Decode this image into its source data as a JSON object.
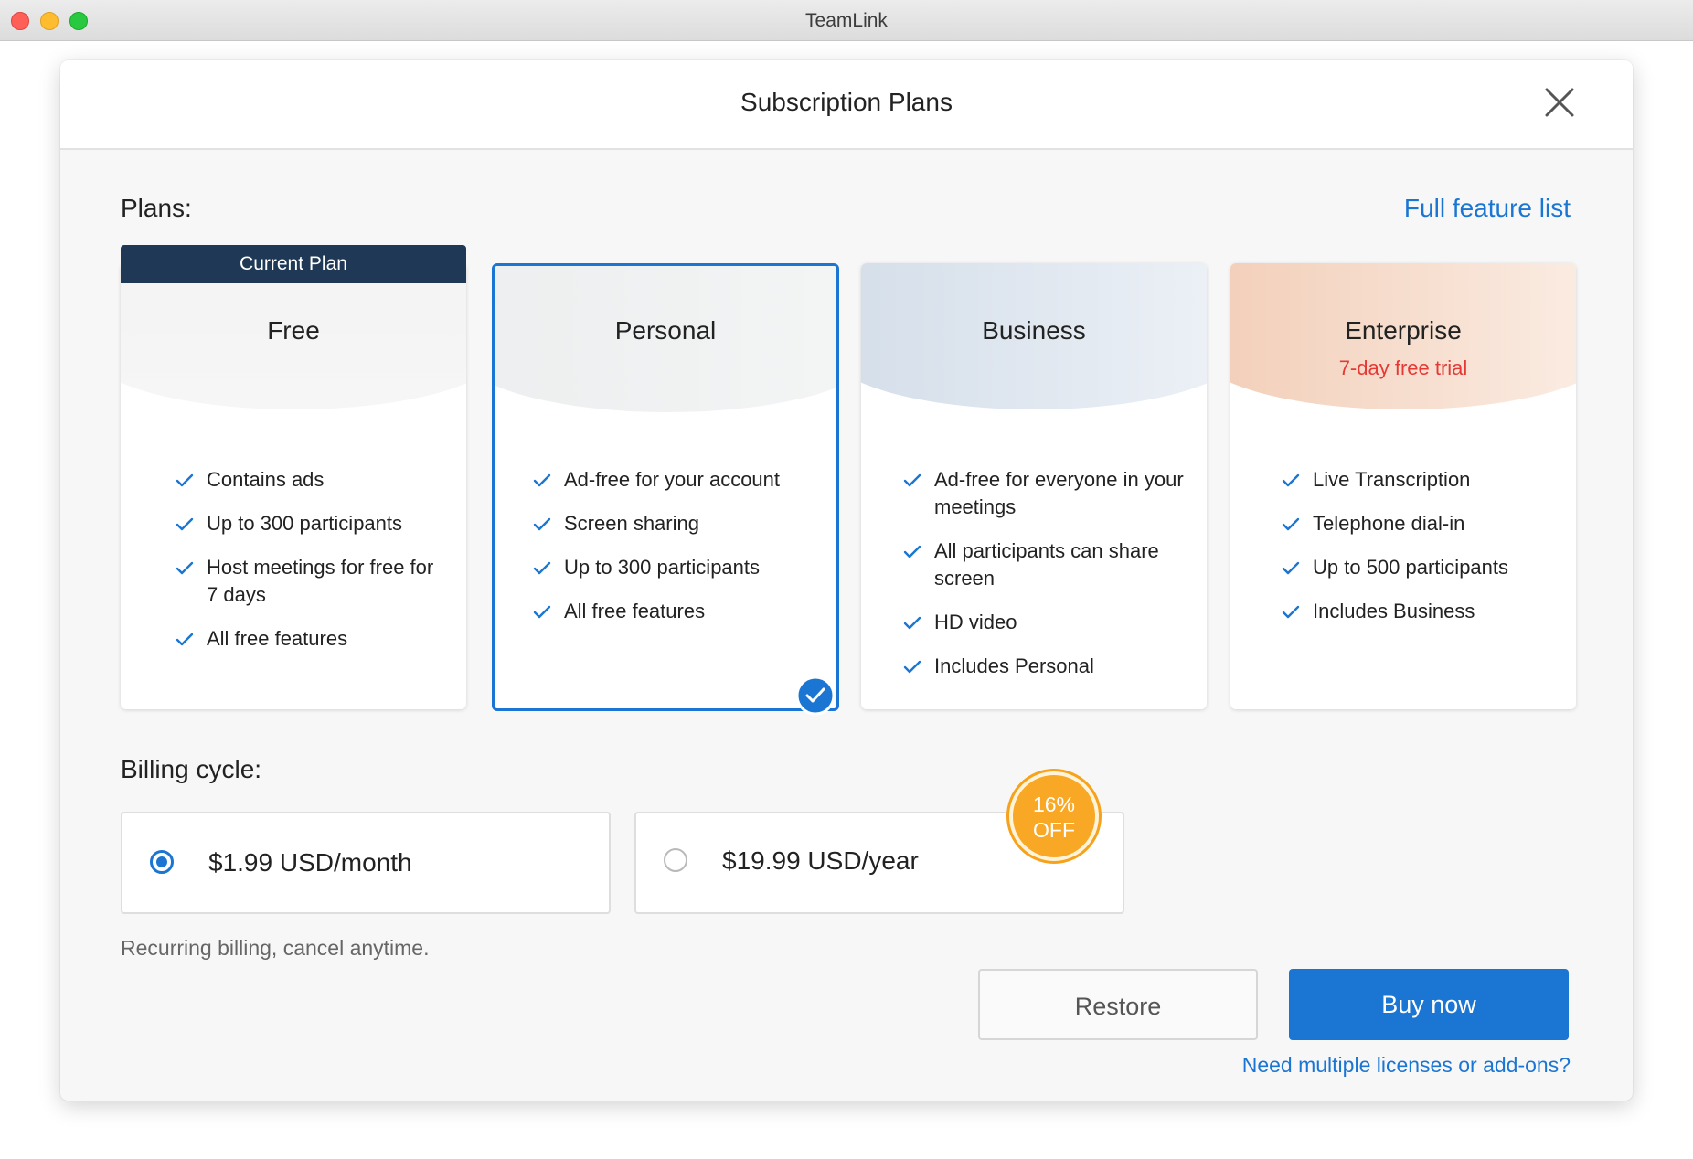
{
  "window": {
    "title": "TeamLink"
  },
  "dialog": {
    "title": "Subscription Plans"
  },
  "plans_section": {
    "label": "Plans:",
    "feature_link": "Full feature list",
    "current_badge": "Current Plan",
    "plans": [
      {
        "name": "Free",
        "trial": "",
        "features": [
          "Contains ads",
          "Up to 300 participants",
          "Host meetings for free for 7 days",
          "All free features"
        ]
      },
      {
        "name": "Personal",
        "trial": "",
        "selected": true,
        "features": [
          "Ad-free for your account",
          "Screen sharing",
          "Up to 300 participants",
          "All free features"
        ]
      },
      {
        "name": "Business",
        "trial": "",
        "features": [
          "Ad-free for everyone in your meetings",
          "All participants can share screen",
          "HD video",
          "Includes Personal"
        ]
      },
      {
        "name": "Enterprise",
        "trial": "7-day free trial",
        "features": [
          "Live Transcription",
          "Telephone dial-in",
          "Up to 500 participants",
          "Includes Business"
        ]
      }
    ]
  },
  "billing": {
    "label": "Billing cycle:",
    "monthly": {
      "amount": "$1.99",
      "unit": "USD/month",
      "selected": true
    },
    "yearly": {
      "amount": "$19.99",
      "unit": "USD/year",
      "selected": false
    },
    "discount_badge": {
      "line1": "16%",
      "line2": "OFF"
    },
    "note": "Recurring billing, cancel anytime."
  },
  "actions": {
    "restore_label": "Restore",
    "buy_label": "Buy now",
    "multiple_licenses_link": "Need multiple licenses or add-ons?"
  },
  "colors": {
    "accent": "#1b76d3",
    "badge_dark": "#1f3855",
    "trial_red": "#e53935",
    "discount_orange": "#f9a825"
  },
  "icons": {
    "close": "close-icon",
    "check": "check-icon",
    "selected": "selected-check-icon"
  }
}
